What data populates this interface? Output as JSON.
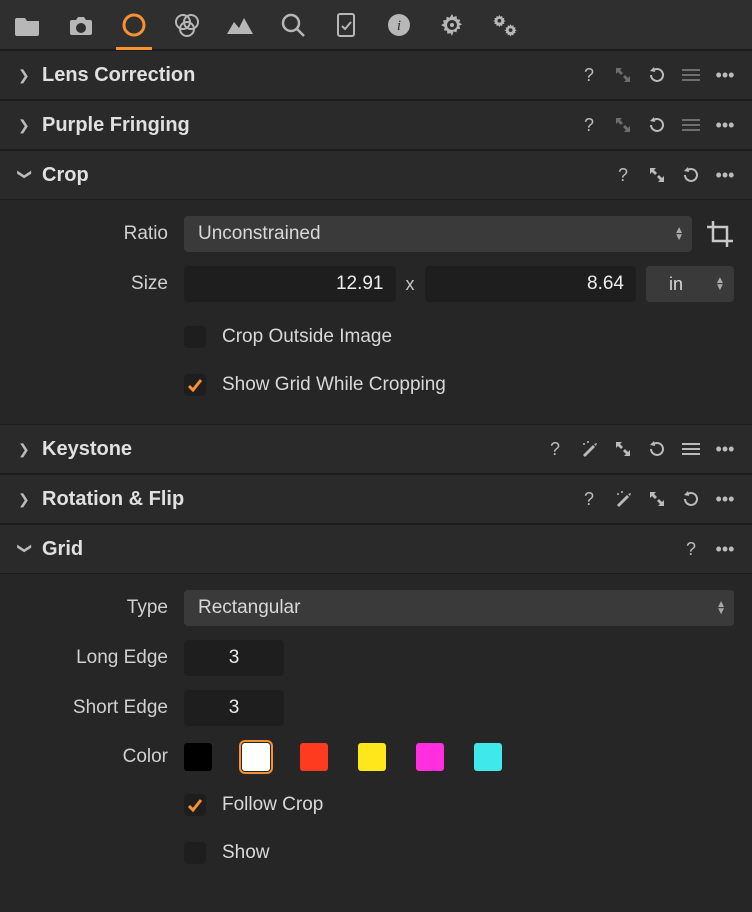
{
  "panels": {
    "lens_correction": {
      "title": "Lens Correction"
    },
    "purple_fringing": {
      "title": "Purple Fringing"
    },
    "crop": {
      "title": "Crop",
      "ratio_label": "Ratio",
      "ratio_value": "Unconstrained",
      "size_label": "Size",
      "size_w": "12.91",
      "size_sep": "x",
      "size_h": "8.64",
      "size_unit": "in",
      "crop_outside_label": "Crop Outside Image",
      "crop_outside_checked": false,
      "show_grid_label": "Show Grid While Cropping",
      "show_grid_checked": true
    },
    "keystone": {
      "title": "Keystone"
    },
    "rotation_flip": {
      "title": "Rotation & Flip"
    },
    "grid": {
      "title": "Grid",
      "type_label": "Type",
      "type_value": "Rectangular",
      "long_edge_label": "Long Edge",
      "long_edge_value": "3",
      "short_edge_label": "Short Edge",
      "short_edge_value": "3",
      "color_label": "Color",
      "colors": [
        "#000000",
        "#ffffff",
        "#ff3b1f",
        "#ffe71c",
        "#ff2fe0",
        "#3fe8ea"
      ],
      "color_selected_index": 1,
      "follow_crop_label": "Follow Crop",
      "follow_crop_checked": true,
      "show_label": "Show",
      "show_checked": false
    }
  }
}
